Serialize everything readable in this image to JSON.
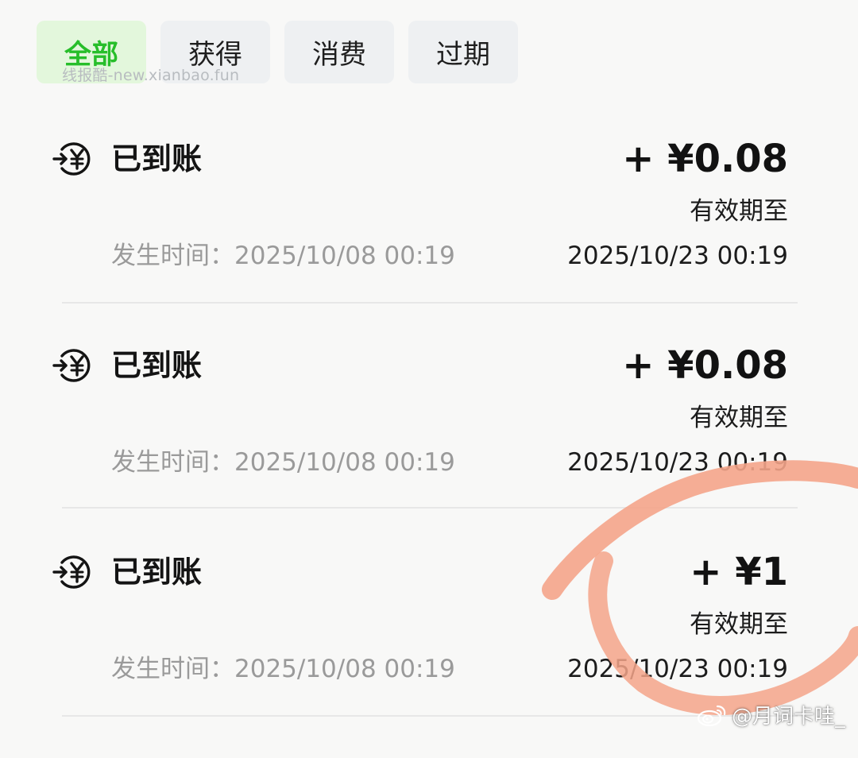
{
  "tabs": [
    {
      "label": "全部",
      "active": true
    },
    {
      "label": "获得",
      "active": false
    },
    {
      "label": "消费",
      "active": false
    },
    {
      "label": "过期",
      "active": false
    }
  ],
  "watermark_top": "线报酷-new.xianbao.fun",
  "records": [
    {
      "status": "已到账",
      "amount": "+ ¥0.08",
      "expiry_label": "有效期至",
      "occur_time": "发生时间：2025/10/08 00:19",
      "expiry_date": "2025/10/23 00:19",
      "icon": "yuan-incoming-icon"
    },
    {
      "status": "已到账",
      "amount": "+ ¥0.08",
      "expiry_label": "有效期至",
      "occur_time": "发生时间：2025/10/08 00:19",
      "expiry_date": "2025/10/23 00:19",
      "icon": "yuan-incoming-icon"
    },
    {
      "status": "已到账",
      "amount": "+ ¥1",
      "expiry_label": "有效期至",
      "occur_time": "发生时间：2025/10/08 00:19",
      "expiry_date": "2025/10/23 00:19",
      "icon": "yuan-incoming-icon"
    }
  ],
  "weibo_watermark": "@月词卡哇_",
  "colors": {
    "active_tab_text": "#27be2a",
    "active_tab_bg": "#e3f7dc",
    "tab_bg": "#eef0f2",
    "highlight_circle": "#f4a489"
  }
}
